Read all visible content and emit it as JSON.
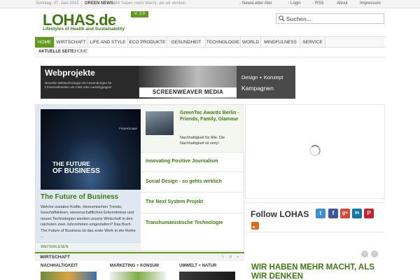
{
  "topbar": {
    "date": "Sonntag, 07. Juni 2015",
    "green_news_label": "GREEN NEWS:",
    "green_news_text": "Wir haben mehr Macht, als wir denken",
    "links": [
      "NewsLetter Abo",
      "Login",
      "RSS",
      "About",
      "Impressum"
    ]
  },
  "logo": {
    "text": "LOHAS.de",
    "version": "V. 2.0",
    "tagline": "Lifestyles of Health and Sustainability"
  },
  "search": {
    "placeholder": "Suchen..."
  },
  "nav": {
    "items": [
      "HOME",
      "WIRTSCHAFT",
      "LIFE AND STYLE",
      "ECO PRODUKTE",
      "GESUNDHEIT",
      "TECHNOLOGIE",
      "WORLD",
      "MINDFULNESS",
      "SERVICE"
    ],
    "active": "HOME"
  },
  "breadcrumb": {
    "label": "AKTUELLE SEITE:",
    "value": "HOME"
  },
  "banner": {
    "title": "Webprojekte",
    "subtitle": "Neueste Webtechnologie mit Anwendungen für Firmenwebseiten als CMS oder Landingpages!",
    "brand": "SCREENWEAVER MEDIA",
    "right_line1": "Design + Konzept",
    "right_line2": "Kampagnen"
  },
  "featured": {
    "image_overlay_small": "FutureScape",
    "image_overlay_1": "THE FUTURE",
    "image_overlay_2": "OF BUSINESS",
    "title": "The Future of Business",
    "text": "Welche sozialen Kräfte, ökonomischen Trends, Geschäftsideen, wissenschaftlichen Erkenntnisse und neuen Technologien werden unsere Wirtschaft in den nächsten zwei Jahrzehnten umgestalten? Das Buch The Future of Business ist das erste Werk in der Reihe ...",
    "more": "WEITERLESEN"
  },
  "feature_list": [
    {
      "title": "GreenTec Awards Berlin - Friends, Family, Glamour",
      "desc": "Nachhaltigkeit für Alle. Die Nachhaltigkeit ist sexy!"
    },
    {
      "title": "Innovating Positive Journalism"
    },
    {
      "title": "Social Design - so gehts wirklich"
    },
    {
      "title": "The Next System Projekt"
    },
    {
      "title": "Transhumanistische Technologie"
    }
  ],
  "follow": {
    "title": "Follow LOHAS",
    "icons": [
      "twitter-icon",
      "facebook-icon",
      "google-plus-icon",
      "linkedin-icon",
      "pinterest-icon"
    ]
  },
  "quote": "WIR HABEN MEHR MACHT, ALS WIR DENKEN",
  "section": {
    "label": "WIRTSCHAFT",
    "categories": [
      "NACHHALTIGKEIT",
      "MARKETING + KONSUM",
      "UMWELT + NATUR"
    ]
  },
  "colors": {
    "brand_green": "#3d7a10",
    "nav_active": "#5e9a1c"
  }
}
